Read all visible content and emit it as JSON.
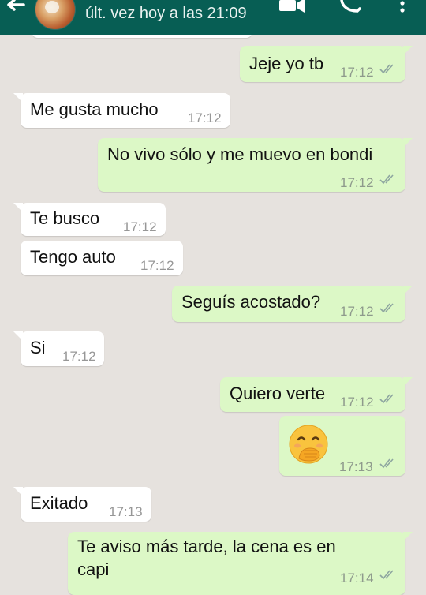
{
  "header": {
    "status": "últ. vez hoy a las 21:09"
  },
  "icons": {
    "back": "back-arrow-icon",
    "video": "video-call-icon",
    "call": "phone-icon",
    "more": "more-options-icon"
  },
  "colors": {
    "header": "#075e54",
    "chat_background": "#e6e2de",
    "incoming_bubble": "#ffffff",
    "outgoing_bubble": "#dcf8c6",
    "read_ticks": "#8ea6a0"
  },
  "messages": [
    {
      "direction": "out",
      "text": "Jeje yo tb",
      "time": "17:12"
    },
    {
      "direction": "in",
      "text": "Me gusta mucho",
      "time": "17:12"
    },
    {
      "direction": "out",
      "text": "No vivo sólo y me muevo en bondi",
      "time": "17:12"
    },
    {
      "direction": "in",
      "text": "Te busco",
      "time": "17:12"
    },
    {
      "direction": "in",
      "text": "Tengo auto",
      "time": "17:12"
    },
    {
      "direction": "out",
      "text": "Seguís acostado?",
      "time": "17:12"
    },
    {
      "direction": "in",
      "text": "Si",
      "time": "17:12"
    },
    {
      "direction": "out",
      "text": "Quiero verte",
      "time": "17:12"
    },
    {
      "direction": "out",
      "emoji": "face-with-hand-over-mouth",
      "time": "17:13"
    },
    {
      "direction": "in",
      "text": "Exitado",
      "time": "17:13"
    },
    {
      "direction": "out",
      "text_line1": "Te aviso más tarde, la cena es en",
      "text_line2": "capi",
      "time": "17:14"
    }
  ]
}
